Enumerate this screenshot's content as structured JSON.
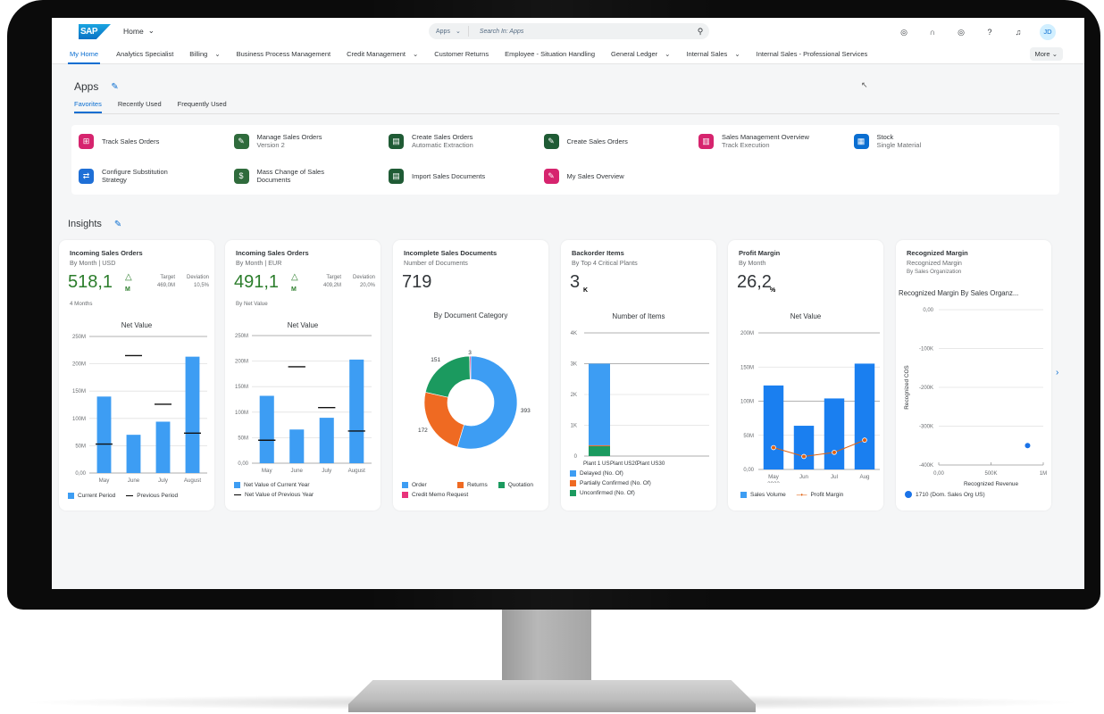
{
  "shell": {
    "logo": "SAP",
    "home_menu": "Home",
    "search_scope": "Apps",
    "search_placeholder": "Search In: Apps",
    "avatar_initials": "JD",
    "icons": [
      "joule-icon",
      "support-headset-icon",
      "copilot-icon",
      "help-icon",
      "notifications-bell-icon"
    ]
  },
  "nav": {
    "items": [
      {
        "label": "My Home",
        "active": true,
        "has_menu": false
      },
      {
        "label": "Analytics Specialist",
        "has_menu": false
      },
      {
        "label": "Billing",
        "has_menu": true
      },
      {
        "label": "Business Process Management",
        "has_menu": false
      },
      {
        "label": "Credit Management",
        "has_menu": true
      },
      {
        "label": "Customer Returns",
        "has_menu": false
      },
      {
        "label": "Employee - Situation Handling",
        "has_menu": false
      },
      {
        "label": "General Ledger",
        "has_menu": true
      },
      {
        "label": "Internal Sales",
        "has_menu": true
      },
      {
        "label": "Internal Sales - Professional Services",
        "has_menu": false
      }
    ],
    "more_label": "More"
  },
  "apps": {
    "title": "Apps",
    "tabs": [
      {
        "label": "Favorites",
        "active": true
      },
      {
        "label": "Recently Used"
      },
      {
        "label": "Frequently Used"
      }
    ],
    "items": [
      {
        "title": "Track Sales Orders",
        "subtitle": "",
        "color": "#d6246e"
      },
      {
        "title": "Manage Sales Orders",
        "subtitle": "Version 2",
        "color": "#2f6b3c"
      },
      {
        "title": "Create Sales Orders",
        "subtitle": "Automatic Extraction",
        "color": "#1f5b35"
      },
      {
        "title": "Create Sales Orders",
        "subtitle": "",
        "color": "#1f5b35"
      },
      {
        "title": "Sales Management Overview",
        "subtitle": "Track Execution",
        "color": "#d6246e"
      },
      {
        "title": "Stock",
        "subtitle": "Single Material",
        "color": "#0a6ed1"
      },
      {
        "title": "Configure Substitution Strategy",
        "subtitle": "",
        "color": "#1f6fd6"
      },
      {
        "title": "Mass Change of Sales Documents",
        "subtitle": "",
        "color": "#2f6b3c"
      },
      {
        "title": "Import Sales Documents",
        "subtitle": "",
        "color": "#1f5b35"
      },
      {
        "title": "My Sales Overview",
        "subtitle": "",
        "color": "#d6246e"
      }
    ]
  },
  "insights": {
    "title": "Insights",
    "cards": [
      {
        "title": "Incoming Sales Orders",
        "subtitle": "By Month | USD",
        "kpi": "518,1",
        "kpi_unit": "M",
        "target_label": "Target",
        "target_value": "469,0M",
        "deviation_label": "Deviation",
        "deviation_value": "10,5%",
        "footer": "4 Months"
      },
      {
        "title": "Incoming Sales Orders",
        "subtitle": "By Month | EUR",
        "kpi": "491,1",
        "kpi_unit": "M",
        "target_label": "Target",
        "target_value": "409,2M",
        "deviation_label": "Deviation",
        "deviation_value": "20,0%",
        "footer": "By Net Value"
      },
      {
        "title": "Incomplete Sales Documents",
        "subtitle": "Number of Documents",
        "kpi": "719"
      },
      {
        "title": "Backorder Items",
        "subtitle": "By Top 4 Critical Plants",
        "kpi": "3",
        "kpi_unit": "K"
      },
      {
        "title": "Profit Margin",
        "subtitle": "By Month",
        "kpi": "26,2",
        "kpi_unit": "%"
      },
      {
        "title": "Recognized Margin",
        "subtitle": "Recognized Margin",
        "subtitle2": "By Sales Organization"
      }
    ]
  },
  "colors": {
    "brand_blue": "#0a6ed1",
    "bar_blue": "#3d9df3",
    "green": "#1b9a5f",
    "orange": "#ef6a22",
    "pink": "#e8337a",
    "line_orange": "#e0600f",
    "kpi_green": "#2b7d2b"
  },
  "chart_data": [
    {
      "type": "bar",
      "title": "Net Value",
      "categories": [
        "May",
        "June",
        "July",
        "August"
      ],
      "series": [
        {
          "name": "Current Period",
          "kind": "bar",
          "values": [
            140,
            70,
            94,
            213
          ]
        },
        {
          "name": "Previous Period",
          "kind": "marker",
          "values": [
            53,
            215,
            126,
            73
          ]
        }
      ],
      "y_ticks": [
        "0,00",
        "50M",
        "100M",
        "150M",
        "200M",
        "250M"
      ],
      "ylim": [
        0,
        250
      ],
      "y_unit": "M",
      "legend": "bottom"
    },
    {
      "type": "bar",
      "title": "Net Value",
      "categories": [
        "May",
        "June",
        "July",
        "August"
      ],
      "series": [
        {
          "name": "Net Value of Current Year",
          "kind": "bar",
          "values": [
            132,
            66,
            89,
            203
          ]
        },
        {
          "name": "Net Value of Previous Year",
          "kind": "marker",
          "values": [
            45,
            189,
            109,
            63
          ]
        }
      ],
      "y_ticks": [
        "0,00",
        "50M",
        "100M",
        "150M",
        "200M",
        "250M"
      ],
      "ylim": [
        0,
        250
      ],
      "y_unit": "M",
      "legend": "bottom"
    },
    {
      "type": "pie",
      "title": "By Document Category",
      "donut": true,
      "categories": [
        "Order",
        "Returns",
        "Quotation",
        "Credit Memo Request"
      ],
      "values": [
        393,
        172,
        151,
        3
      ],
      "colors": [
        "#3d9df3",
        "#ef6a22",
        "#1b9a5f",
        "#e8337a"
      ],
      "legend": "bottom"
    },
    {
      "type": "bar",
      "stacked": true,
      "title": "Number of Items",
      "categories": [
        "Plant 1 US",
        "Plant US20",
        "Plant US30"
      ],
      "series": [
        {
          "name": "Delayed (No. Of)",
          "values": [
            2650,
            0,
            0
          ],
          "color": "#3d9df3"
        },
        {
          "name": "Partially Confirmed (No. Of)",
          "values": [
            30,
            0,
            0
          ],
          "color": "#ef6a22"
        },
        {
          "name": "Unconfirmed (No. Of)",
          "values": [
            320,
            0,
            0
          ],
          "color": "#1b9a5f"
        }
      ],
      "y_ticks": [
        "0",
        "1K",
        "2K",
        "3K",
        "4K"
      ],
      "ylim": [
        0,
        4000
      ],
      "legend": "bottom"
    },
    {
      "type": "bar",
      "title": "Net Value",
      "categories": [
        "May 2022",
        "Jun",
        "Jul",
        "Aug"
      ],
      "category_lines": [
        [
          "May",
          "2022"
        ],
        [
          "Jun"
        ],
        [
          "Jul"
        ],
        [
          "Aug"
        ]
      ],
      "series": [
        {
          "name": "Sales Volume",
          "kind": "bar",
          "values": [
            123,
            64,
            104,
            155
          ]
        },
        {
          "name": "Profit Margin",
          "kind": "line",
          "values": [
            32,
            19,
            25,
            43
          ]
        }
      ],
      "y_ticks": [
        "0,00",
        "50M",
        "100M",
        "150M",
        "200M"
      ],
      "ylim": [
        0,
        200
      ],
      "y_unit": "M",
      "legend": "bottom"
    },
    {
      "type": "scatter",
      "title": "Recognized Margin By Sales Organz...",
      "xlabel": "Recognized Revenue",
      "ylabel": "Recognized COS",
      "x_ticks": [
        "0,00",
        "500K",
        "1M"
      ],
      "y_ticks": [
        "0,00",
        "-100K",
        "-200K",
        "-300K",
        "-400K"
      ],
      "xlim": [
        0,
        1000000
      ],
      "ylim": [
        -400000,
        0
      ],
      "series": [
        {
          "name": "1710 (Dom. Sales Org US)",
          "points": [
            [
              850000,
              -350000
            ]
          ]
        }
      ],
      "legend": "bottom"
    }
  ]
}
